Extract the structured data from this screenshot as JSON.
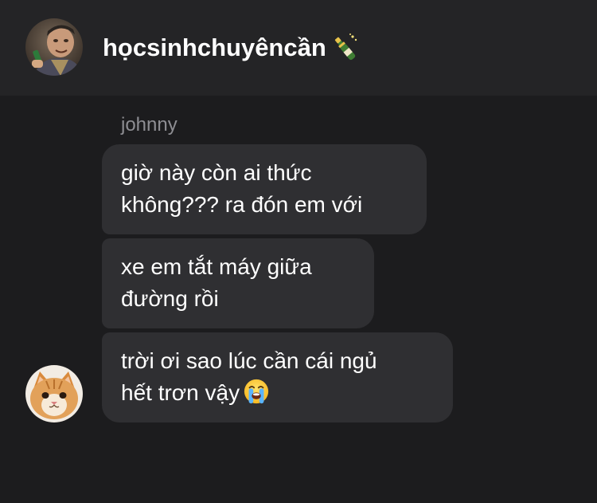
{
  "conversation": {
    "title": "họcsinhchuyêncần",
    "title_emoji": "champagne-bottle-icon"
  },
  "sender_name": "johnny",
  "messages": [
    {
      "lines": [
        "giờ này còn ai thức",
        "không??? ra đón em với"
      ]
    },
    {
      "lines": [
        "xe em tắt máy giữa",
        "đường rồi"
      ]
    },
    {
      "lines": [
        "trời ơi sao lúc cần cái ngủ",
        "hết trơn vậy"
      ],
      "trailing_emoji": "loudly-crying-face-icon"
    }
  ],
  "colors": {
    "background": "#1c1c1e",
    "header": "#242426",
    "bubble": "#2f2f32",
    "sender": "#8e8e93",
    "text": "#ffffff"
  }
}
